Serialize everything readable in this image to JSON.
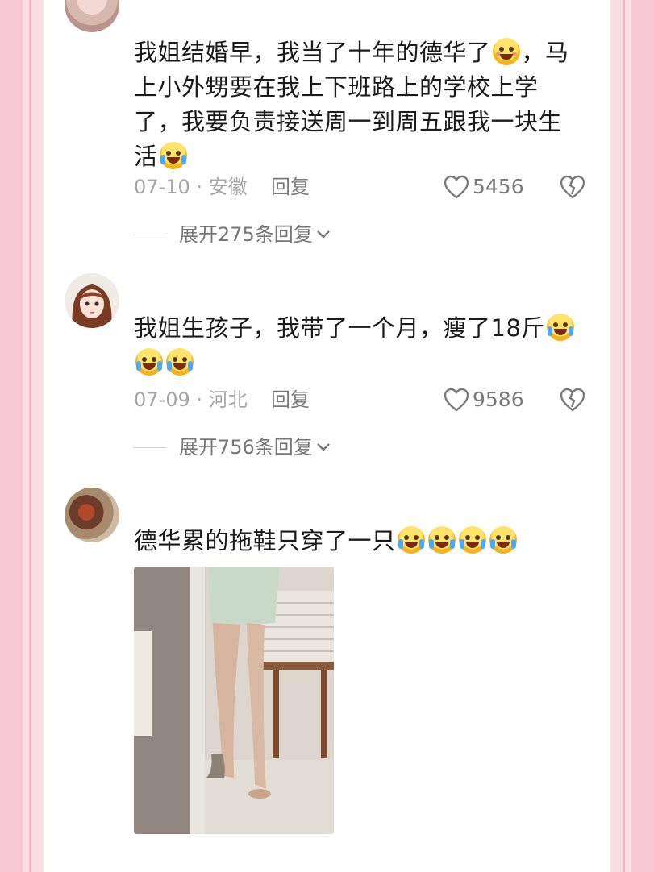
{
  "comments": [
    {
      "text_lines": [
        "我姐结婚早，我当了十年的德华了",
        "，马",
        "上小外甥要在我上下班路上的学校上学",
        "了，我要负责接送周一到周五跟我一块生",
        "活"
      ],
      "date": "07-10",
      "location": "安徽",
      "reply_label": "回复",
      "likes": "5456",
      "expand_label": "展开275条回复"
    },
    {
      "text_lines": [
        "我姐生孩子，我带了一个月，瘦了18斤"
      ],
      "date": "07-09",
      "location": "河北",
      "reply_label": "回复",
      "likes": "9586",
      "expand_label": "展开756条回复"
    },
    {
      "text_lines": [
        "德华累的拖鞋只穿了一只"
      ]
    }
  ],
  "meta_separator": "·",
  "colors": {
    "frame_pink": "#f6c9d4",
    "text": "#1a1a1a",
    "meta": "#a6a6a6"
  },
  "icons": [
    "heart-icon",
    "broken-heart-icon",
    "chevron-down-icon",
    "laugh-cry-emoji",
    "happy-emoji"
  ]
}
